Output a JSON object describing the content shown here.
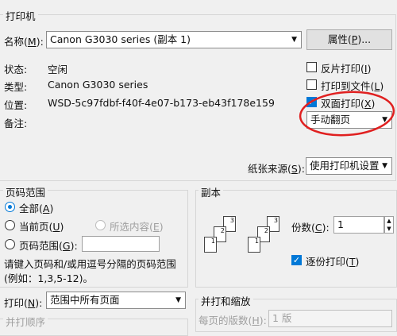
{
  "printer_section": {
    "title": "打印机",
    "name_label": "名称(",
    "name_key": "M",
    "name_label_end": "):",
    "name_value": "Canon G3030 series (副本 1)",
    "properties_label": "属性(",
    "properties_key": "P",
    "properties_label_end": ")...",
    "status_label": "状态:",
    "status_value": "空闲",
    "type_label": "类型:",
    "type_value": "Canon G3030 series",
    "where_label": "位置:",
    "where_value": "WSD-5c97fdbf-f40f-4e07-b173-eb43f178e159",
    "comment_label": "备注:",
    "reverse_print": {
      "label": "反片打印(",
      "key": "I",
      "end": ")",
      "checked": false
    },
    "print_to_file": {
      "label": "打印到文件(",
      "key": "L",
      "end": ")",
      "checked": false
    },
    "duplex": {
      "label": "双面打印(",
      "key": "X",
      "end": ")",
      "checked": true
    },
    "duplex_mode": "手动翻页",
    "paper_source_label": "纸张来源(",
    "paper_source_key": "S",
    "paper_source_end": "):",
    "paper_source_value": "使用打印机设置"
  },
  "page_range": {
    "title": "页码范围",
    "all": {
      "label": "全部(",
      "key": "A",
      "end": ")"
    },
    "current": {
      "label": "当前页(",
      "key": "U",
      "end": ")"
    },
    "selection": {
      "label": "所选内容(",
      "key": "E",
      "end": ")"
    },
    "pages": {
      "label": "页码范围(",
      "key": "G",
      "end": "):"
    },
    "pages_value": "",
    "hint_line1": "请键入页码和/或用逗号分隔的页码范围",
    "hint_line2": "(例如：1,3,5-12)。"
  },
  "copies": {
    "title": "副本",
    "count_label": "份数(",
    "count_key": "C",
    "count_end": "):",
    "count_value": "1",
    "collate": {
      "label": "逐份打印(",
      "key": "T",
      "end": ")",
      "checked": true
    },
    "page_labels": [
      "1",
      "2",
      "3"
    ]
  },
  "print_what": {
    "label": "打印(",
    "key": "N",
    "end": "):",
    "value": "范围中所有页面",
    "order_label": "并打顺序"
  },
  "zoom": {
    "title": "并打和缩放",
    "pages_per_sheet_label": "每页的版数(",
    "pages_per_sheet_key": "H",
    "pages_per_sheet_end": "):",
    "pages_per_sheet_value": "1 版"
  },
  "colors": {
    "accent": "#0078d7",
    "annotation": "#e02020"
  }
}
